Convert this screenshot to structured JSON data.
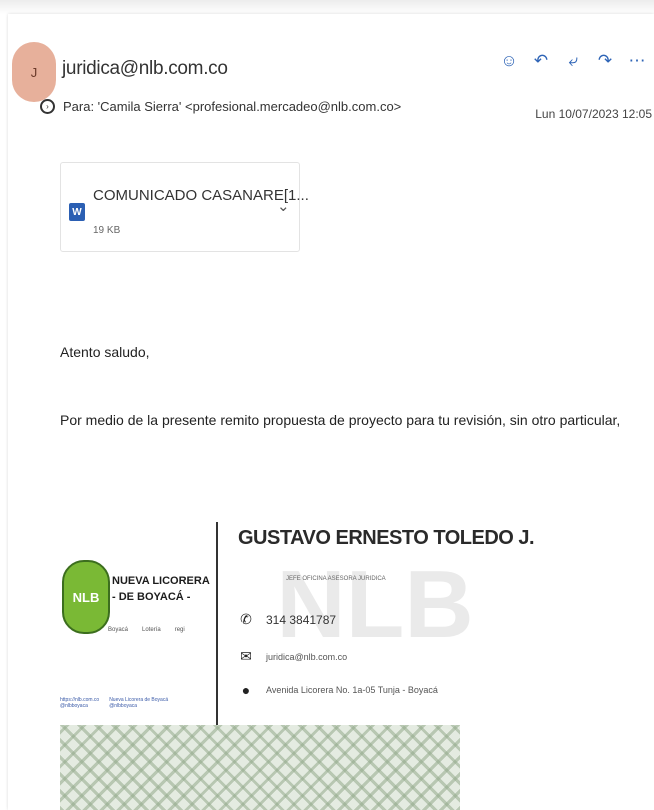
{
  "email": {
    "avatar_initial": "J",
    "sender": "juridica@nlb.com.co",
    "to_line": "Para:  'Camila Sierra' <profesional.mercadeo@nlb.com.co>",
    "date": "Lun 10/07/2023 12:05",
    "actions": [
      {
        "name": "emoji-icon",
        "glyph": "☺"
      },
      {
        "name": "reply-icon",
        "glyph": "↶"
      },
      {
        "name": "reply-all-icon",
        "glyph": "⤶"
      },
      {
        "name": "forward-icon",
        "glyph": "↷"
      },
      {
        "name": "more-icon",
        "glyph": "⋯"
      }
    ]
  },
  "attachment": {
    "name": "COMUNICADO CASANARE[1...",
    "size": "19 KB",
    "icon_letter": "W"
  },
  "body": {
    "greeting": "Atento saludo,",
    "message": "Por medio de la presente remito propuesta de proyecto para tu revisión, sin otro particular,"
  },
  "signature": {
    "name": "GUSTAVO ERNESTO TOLEDO J.",
    "role": "JEFE OFICINA ASESORA JURIDICA",
    "phone": "314 3841787",
    "email": "juridica@nlb.com.co",
    "address": "Avenida Licorera No. 1a-05 Tunja - Boyacá",
    "logo_text": "NLB",
    "brand_line1": "NUEVA LICORERA",
    "brand_line2": "- DE BOYACÁ -",
    "mini_logos": [
      "Boyacá",
      "Lotería",
      "regi"
    ],
    "social": [
      "https://nlb.com.co",
      "Nueva Licorera de Boyacá",
      "@nlbboyaca",
      "@nlbboyaca"
    ],
    "watermark": "NLB"
  },
  "colors": {
    "accent": "#2e64b6",
    "avatar_bg": "#e7b09b",
    "logo_green": "#7ab935"
  }
}
